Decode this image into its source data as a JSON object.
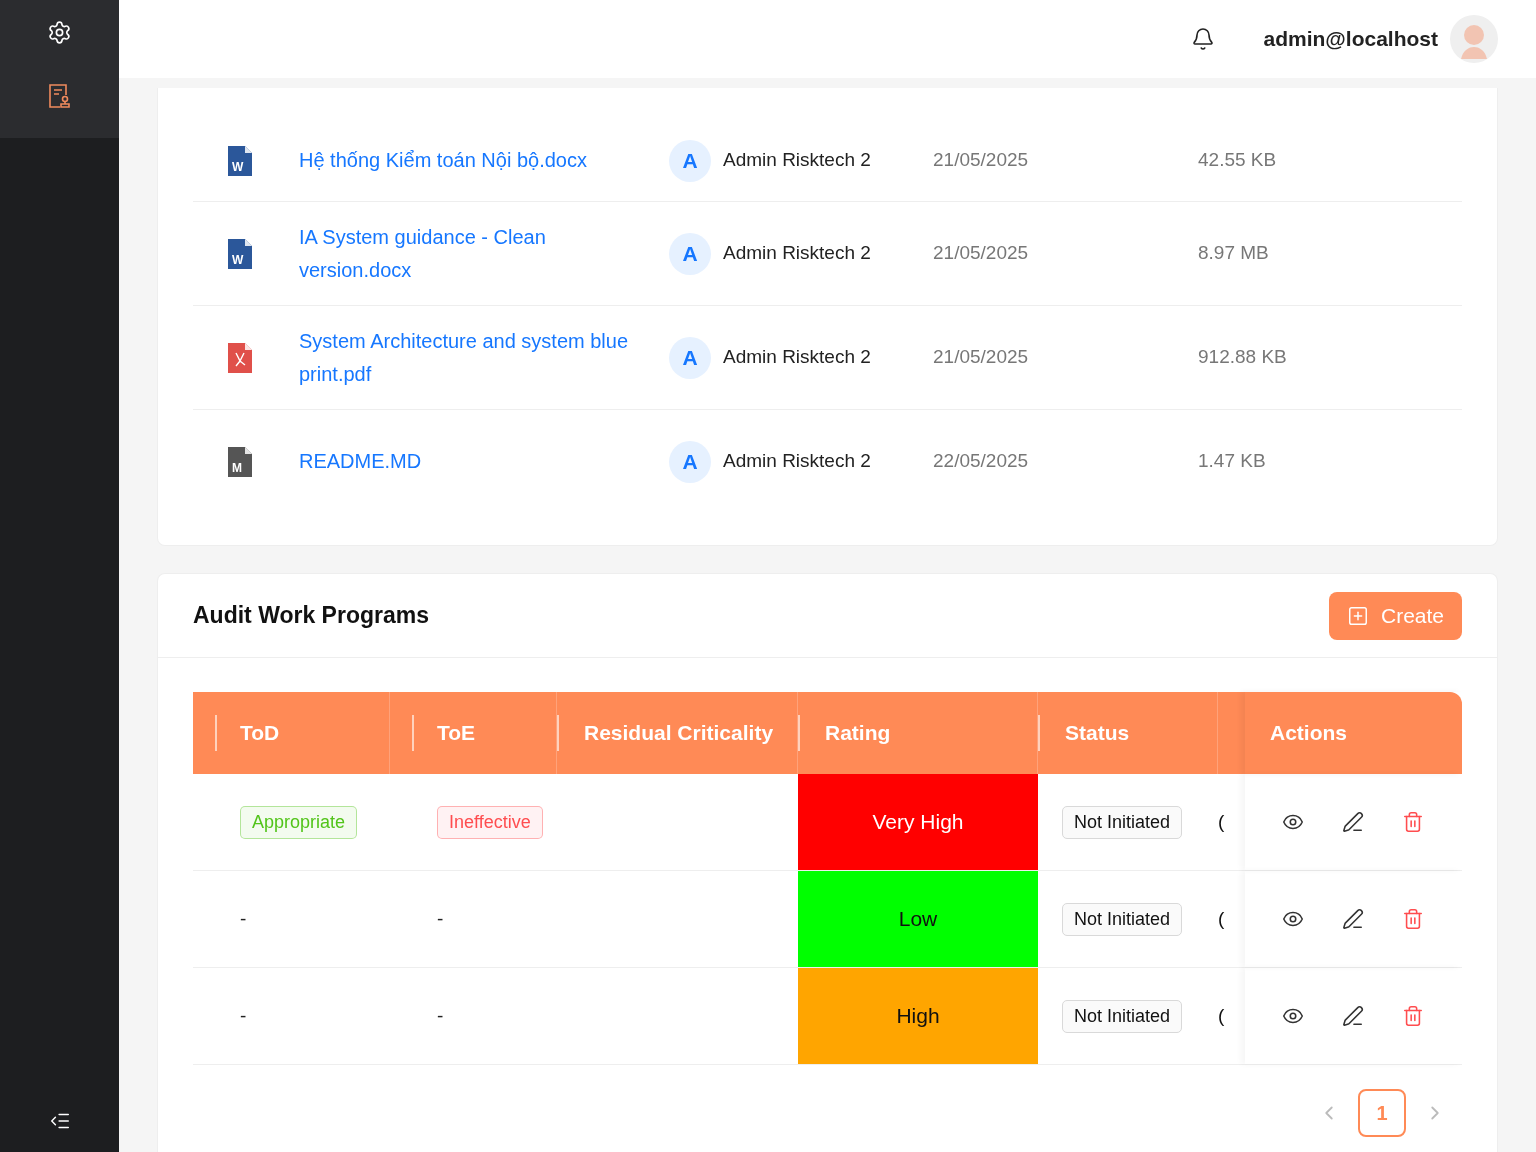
{
  "sidebar": {
    "items": [
      {
        "kind": "settings",
        "selected": false
      },
      {
        "kind": "document",
        "selected": true
      }
    ]
  },
  "header": {
    "user": "admin@localhost"
  },
  "files": [
    {
      "kind": "word",
      "badge": "W",
      "name": "Hệ thống Kiểm toán Nội bộ.docx",
      "avatar": "A",
      "owner": "Admin Risktech 2",
      "date": "21/05/2025",
      "size": "42.55 KB"
    },
    {
      "kind": "word",
      "badge": "W",
      "name": "IA System guidance - Clean version.docx",
      "avatar": "A",
      "owner": "Admin Risktech 2",
      "date": "21/05/2025",
      "size": "8.97 MB"
    },
    {
      "kind": "pdf",
      "name": "System Architecture and system blue print.pdf",
      "avatar": "A",
      "owner": "Admin Risktech 2",
      "date": "21/05/2025",
      "size": "912.88 KB"
    },
    {
      "kind": "markdown",
      "badge": "M",
      "name": "README.MD",
      "avatar": "A",
      "owner": "Admin Risktech 2",
      "date": "22/05/2025",
      "size": "1.47 KB"
    }
  ],
  "programs": {
    "title": "Audit Work Programs",
    "create_button": "Create",
    "columns": [
      "ToD",
      "ToE",
      "Residual Criticality",
      "Rating",
      "Status",
      "Actions"
    ],
    "rows": [
      {
        "tod": {
          "kind": "tag",
          "text": "Appropriate",
          "color": "#52c41a"
        },
        "toe": {
          "kind": "tag",
          "text": "Ineffective",
          "color": "#ff4d4f"
        },
        "rating": "Very High",
        "color": "#ff0000",
        "status": "Not Initiated",
        "column_6": "("
      },
      {
        "tod": {
          "kind": "plain",
          "text": "-"
        },
        "toe": {
          "kind": "plain",
          "text": "-"
        },
        "rating": "Low",
        "color": "#00ff00",
        "status": "Not Initiated",
        "column_6": "("
      },
      {
        "tod": {
          "kind": "plain",
          "text": "-"
        },
        "toe": {
          "kind": "plain",
          "text": "-"
        },
        "rating": "High",
        "color": "#ffa500",
        "status": "Not Initiated",
        "column_6": "("
      }
    ],
    "pagination": [
      {
        "label": "1",
        "selected": true
      }
    ]
  }
}
